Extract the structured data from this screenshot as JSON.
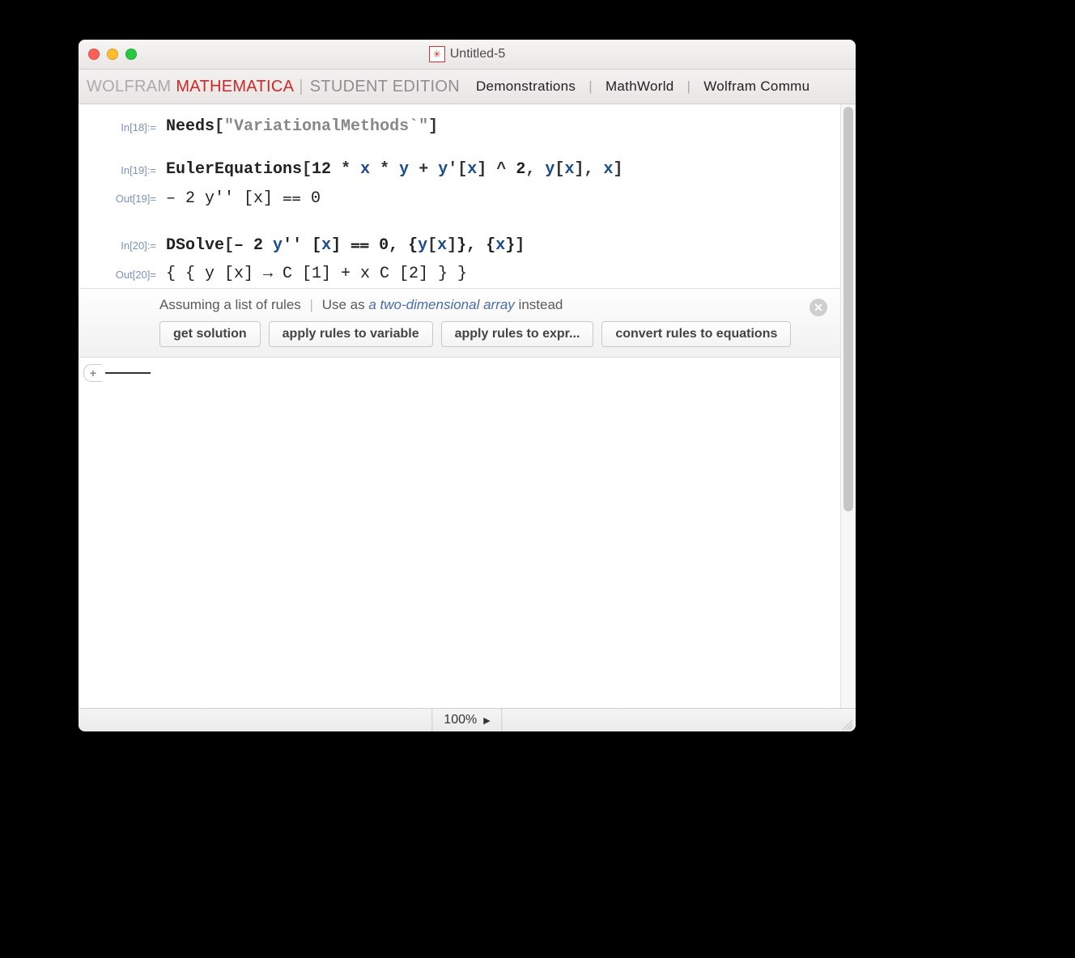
{
  "window": {
    "title": "Untitled-5"
  },
  "brand": {
    "wolfram": "WOLFRAM",
    "mathematica": "MATHEMATICA",
    "student": "STUDENT EDITION"
  },
  "toolbar_links": {
    "demonstrations": "Demonstrations",
    "mathworld": "MathWorld",
    "community": "Wolfram Commu"
  },
  "cells": {
    "in18": {
      "label": "In[18]:=",
      "fn": "Needs",
      "arg_str": "\"VariationalMethods`\""
    },
    "in19": {
      "label": "In[19]:=",
      "fn": "EulerEquations",
      "expr_lead": "12",
      "mul1": "*",
      "x1": "x",
      "mul2": "*",
      "y1": "y",
      "plus": "+",
      "y2": "y",
      "prime": "'",
      "lb1": "[",
      "x2": "x",
      "rb1": "]",
      "caret": "^",
      "two": "2",
      "comma1": ",",
      "y3": "y",
      "lb2": "[",
      "x3": "x",
      "rb2": "]",
      "comma2": ",",
      "x4": "x"
    },
    "out19": {
      "label": "Out[19]=",
      "text": "– 2 y′′ [x] ⩵ 0"
    },
    "in20": {
      "label": "In[20]:=",
      "fn": "DSolve",
      "arg1": "– 2 ",
      "y": "y",
      "pp": "′′",
      "lb": " [",
      "x1": "x",
      "rb": "]",
      "eq": " ⩵ 0,",
      "lb2": " {",
      "y2": "y",
      "lb3": "[",
      "x2": "x",
      "rb3": "]",
      "rb2": "},",
      "lb4": " {",
      "x3": "x",
      "rb4": "}"
    },
    "out20": {
      "label": "Out[20]=",
      "text": "{ { y [x] → C [1] + x C [2] } }"
    }
  },
  "suggest": {
    "assume": "Assuming a list of rules",
    "use_as": "Use as",
    "link": "a two-dimensional array",
    "instead": "instead",
    "buttons": {
      "b1": "get solution",
      "b2": "apply rules to variable",
      "b3": "apply rules to expr...",
      "b4": "convert rules to equations"
    }
  },
  "status": {
    "zoom": "100%",
    "arrow": "▶"
  },
  "colors": {
    "accent": "#d42626",
    "symbol": "#1a4b8c",
    "label": "#7a91bf"
  }
}
